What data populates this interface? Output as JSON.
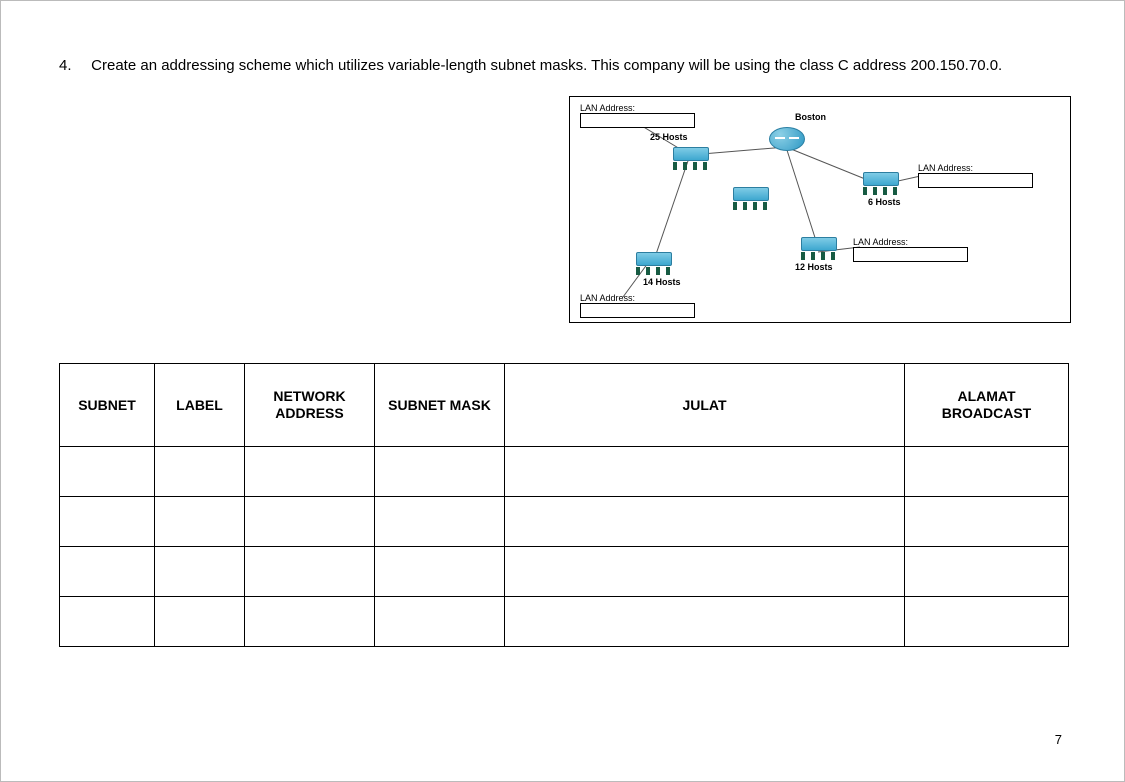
{
  "question_number": "4.",
  "question_text": "Create an addressing scheme which utilizes variable-length subnet masks. This company will be using the class C address 200.150.70.0.",
  "diagram": {
    "router_label": "Boston",
    "lan_label": "LAN Address:",
    "hosts_top": "25 Hosts",
    "hosts_right1": "6 Hosts",
    "hosts_right2": "12 Hosts",
    "hosts_bottom": "14 Hosts"
  },
  "table": {
    "headers": [
      "SUBNET",
      "LABEL",
      "NETWORK ADDRESS",
      "SUBNET MASK",
      "JULAT",
      "ALAMAT BROADCAST"
    ],
    "rows": [
      [
        "",
        "",
        "",
        "",
        "",
        ""
      ],
      [
        "",
        "",
        "",
        "",
        "",
        ""
      ],
      [
        "",
        "",
        "",
        "",
        "",
        ""
      ],
      [
        "",
        "",
        "",
        "",
        "",
        ""
      ]
    ]
  },
  "page_number": "7"
}
